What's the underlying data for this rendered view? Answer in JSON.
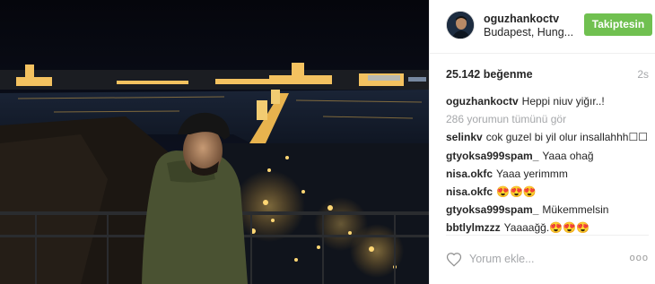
{
  "post": {
    "username": "oguzhankoctv",
    "location": "Budapest, Hung...",
    "follow_label": "Takiptesin",
    "likes": "25.142 beğenme",
    "time_ago": "2s",
    "caption_user": "oguzhankoctv",
    "caption_text": "Heppi niuv yiğır..!",
    "view_all": "286 yorumun tümünü gör",
    "comments": [
      {
        "user": "selinkv",
        "text": "cok guzel bi yil olur insallahhh☐☐"
      },
      {
        "user": "gtyoksa999spam_",
        "text": "Yaaa ohağ"
      },
      {
        "user": "nisa.okfc",
        "text": "Yaaa yerimmm"
      },
      {
        "user": "nisa.okfc",
        "text": "😍😍😍"
      },
      {
        "user": "gtyoksa999spam_",
        "text": "Mükemmelsin"
      },
      {
        "user": "bbtlylmzzz",
        "text": "Yaaaağğ.😍😍😍"
      }
    ],
    "add_comment_placeholder": "Yorum ekle...",
    "more_label": "ooo"
  },
  "colors": {
    "follow_green": "#70c050",
    "muted_gray": "#a5a7aa",
    "text": "#262626",
    "border": "#efefef"
  },
  "icons": [
    "heart-icon",
    "more-options-icon"
  ]
}
